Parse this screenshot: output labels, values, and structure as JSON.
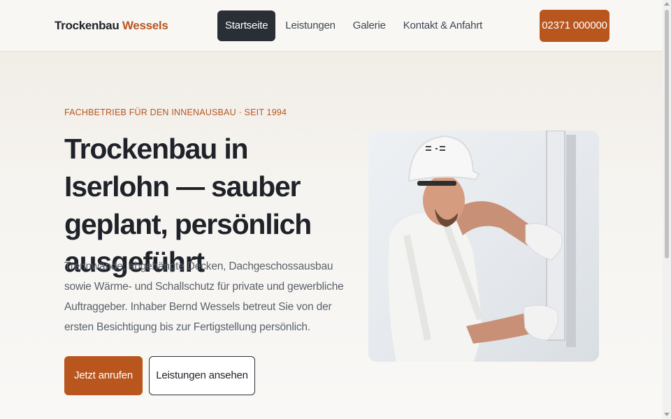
{
  "header": {
    "brand_main": "Trockenbau",
    "brand_accent": "Wessels",
    "nav": [
      {
        "label": "Startseite",
        "active": true
      },
      {
        "label": "Leistungen",
        "active": false
      },
      {
        "label": "Galerie",
        "active": false
      },
      {
        "label": "Kontakt & Anfahrt",
        "active": false
      }
    ],
    "phone": "02371 000000"
  },
  "hero": {
    "eyebrow": "FACHBETRIEB FÜR DEN INNENAUSBAU · SEIT 1994",
    "headline": "Trockenbau in Iserlohn — sauber geplant, persönlich ausgeführt",
    "lead": "Trennwände, abgehängte Decken, Dachgeschossausbau sowie Wärme- und Schallschutz für private und gewerbliche Auftraggeber. Inhaber Bernd Wessels betreut Sie von der ersten Besichtigung bis zur Fertigstellung persönlich.",
    "primary_cta": "Jetzt anrufen",
    "secondary_cta": "Leistungen ansehen"
  },
  "colors": {
    "accent": "#b8561e",
    "dark": "#2a2f36",
    "background": "#f6f4f0"
  }
}
